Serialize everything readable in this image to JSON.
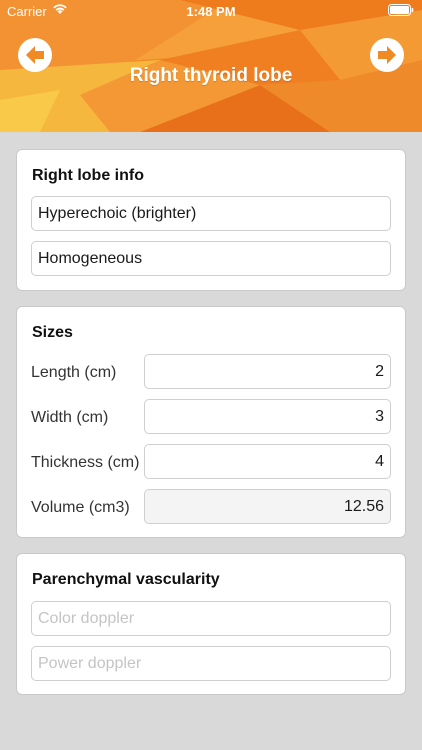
{
  "status_bar": {
    "carrier": "Carrier",
    "time": "1:48 PM"
  },
  "header": {
    "title": "Right thyroid lobe",
    "back_icon": "arrow-left-icon",
    "forward_icon": "arrow-right-icon",
    "accent_color": "#f08a24",
    "button_color": "#ffffff"
  },
  "right_lobe_info": {
    "title": "Right lobe info",
    "echogenicity": "Hyperechoic (brighter)",
    "echotexture": "Homogeneous"
  },
  "sizes": {
    "title": "Sizes",
    "rows": [
      {
        "label": "Length (cm)",
        "value": "2"
      },
      {
        "label": "Width (cm)",
        "value": "3"
      },
      {
        "label": "Thickness (cm)",
        "value": "4"
      },
      {
        "label": "Volume (cm3)",
        "value": "12.56"
      }
    ]
  },
  "vascularity": {
    "title": "Parenchymal vascularity",
    "color_doppler_placeholder": "Color doppler",
    "power_doppler_placeholder": "Power doppler"
  }
}
